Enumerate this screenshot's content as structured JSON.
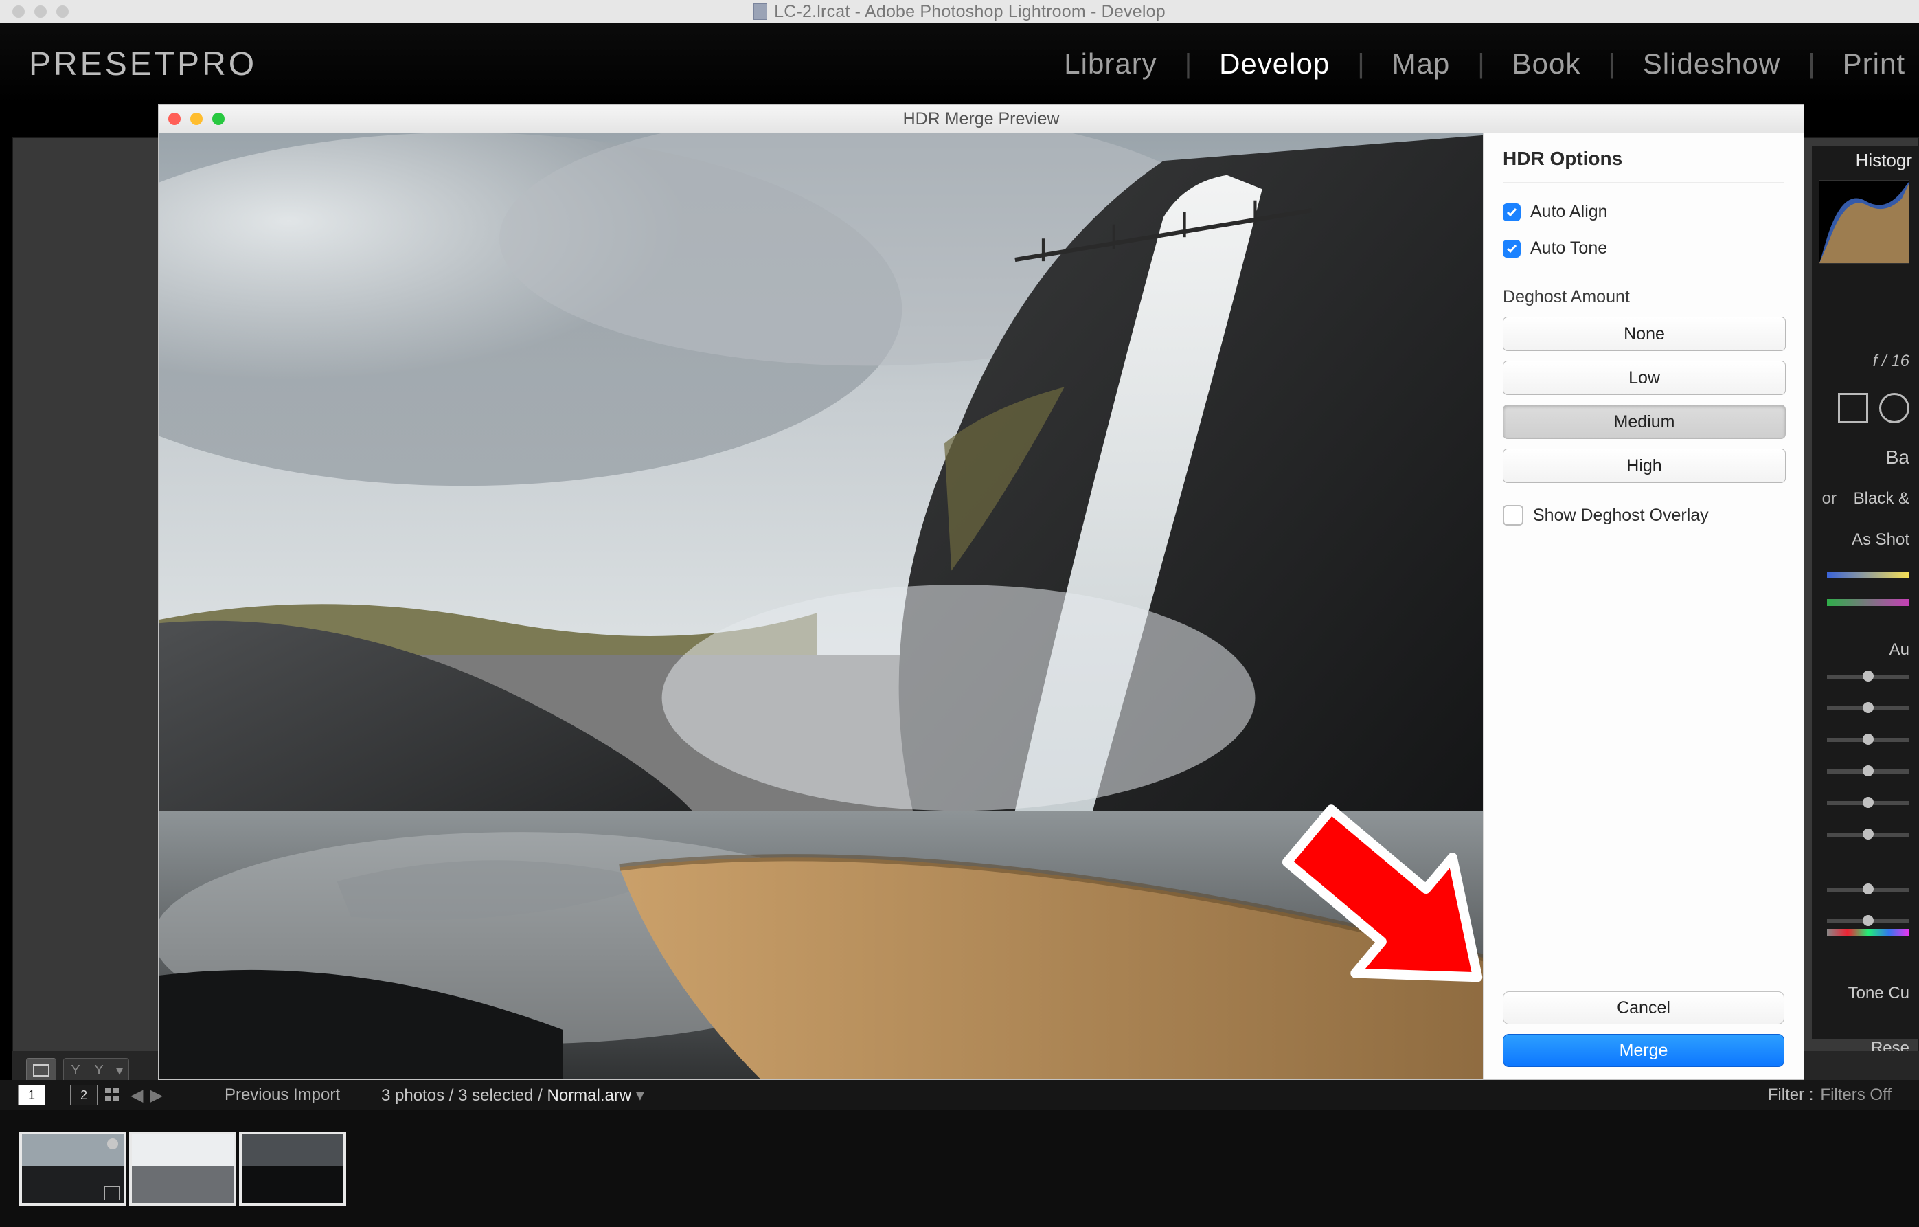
{
  "mac_title": "LC-2.lrcat - Adobe Photoshop Lightroom - Develop",
  "brand": "PRESETPRO",
  "nav": {
    "library": "Library",
    "develop": "Develop",
    "map": "Map",
    "book": "Book",
    "slideshow": "Slideshow",
    "print": "Print"
  },
  "modal": {
    "title": "HDR Merge Preview",
    "options_title": "HDR Options",
    "auto_align": "Auto Align",
    "auto_tone": "Auto Tone",
    "deghost_label": "Deghost Amount",
    "deghost": {
      "none": "None",
      "low": "Low",
      "medium": "Medium",
      "high": "High"
    },
    "show_overlay": "Show Deghost Overlay",
    "cancel": "Cancel",
    "merge": "Merge"
  },
  "develop": {
    "histogram": "Histogr",
    "fstop": "f / 16",
    "basic": "Ba",
    "color": "or",
    "bw": "Black &",
    "asshot": "As Shot",
    "auto": "Au",
    "tone_curve": "Tone Cu",
    "reset": "Rese"
  },
  "film": {
    "badge1": "1",
    "badge2": "2",
    "previous": "Previous Import",
    "crumb": "3 photos / 3 selected /",
    "file": "Normal.arw",
    "filter": "Filter :",
    "filter_val": "Filters Off"
  }
}
